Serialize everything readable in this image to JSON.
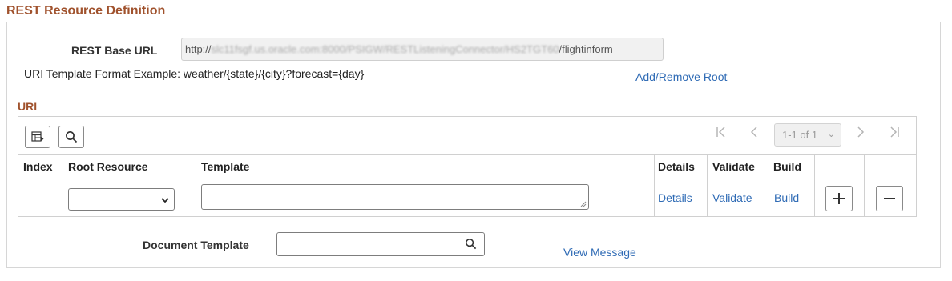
{
  "section": {
    "title": "REST Resource Definition"
  },
  "base_url": {
    "label": "REST Base URL",
    "value_prefix": "http://",
    "value_obscured": "slc11fsgf.us.oracle.com:8000/PSIGW/RESTListeningConnector/HS2TGT60",
    "value_suffix": "/flightinform"
  },
  "uri_example": "URI Template Format Example: weather/{state}/{city}?forecast={day}",
  "add_remove_root_link": "Add/Remove Root",
  "uri_grid": {
    "title": "URI",
    "toolbar": {
      "personalize_icon": "grid-personalize-icon",
      "search_icon": "search-icon"
    },
    "pager": {
      "range_label": "1-1 of 1",
      "first_icon": "first-page-icon",
      "prev_icon": "previous-page-icon",
      "next_icon": "next-page-icon",
      "last_icon": "last-page-icon"
    },
    "columns": [
      "Index",
      "Root Resource",
      "Template",
      "Details",
      "Validate",
      "Build"
    ],
    "rows": [
      {
        "index": "",
        "root_resource": "",
        "template": "",
        "details_link": "Details",
        "validate_link": "Validate",
        "build_link": "Build"
      }
    ],
    "add_row_icon": "plus-icon",
    "delete_row_icon": "minus-icon"
  },
  "document_template": {
    "label": "Document Template",
    "value": "",
    "search_icon": "search-icon"
  },
  "view_message_link": "View Message"
}
